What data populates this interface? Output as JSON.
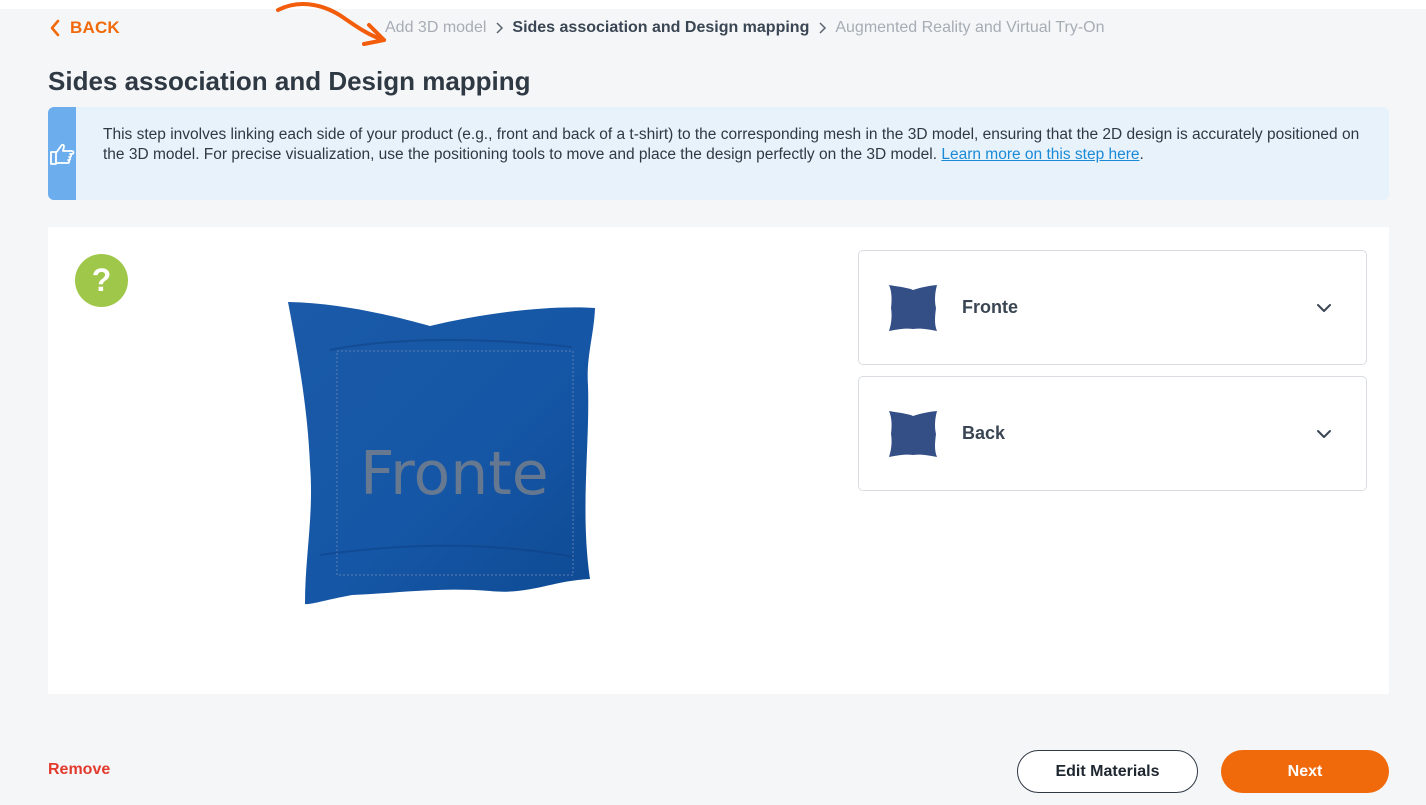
{
  "nav": {
    "back_label": "BACK",
    "breadcrumb": [
      "Add 3D model",
      "Sides association and Design mapping",
      "Augmented Reality and Virtual Try-On"
    ]
  },
  "page": {
    "title": "Sides association and Design mapping"
  },
  "info": {
    "text": "This step involves linking each side of your product (e.g., front and back of a t-shirt) to the corresponding mesh in the 3D model, ensuring that the 2D design is accurately positioned on the 3D model. For precise visualization, use the positioning tools to move and place the design perfectly on the 3D model. ",
    "link_text": "Learn more on this step here",
    "trailing": "."
  },
  "viewer": {
    "help_label": "?",
    "design_text": "Fronte"
  },
  "sides": [
    {
      "label": "Fronte"
    },
    {
      "label": "Back"
    }
  ],
  "footer": {
    "remove_label": "Remove",
    "edit_label": "Edit Materials",
    "next_label": "Next"
  },
  "colors": {
    "accent": "#f06a0c",
    "info_bar": "#6cadee",
    "info_bg": "#e8f2fb",
    "help_badge": "#9fc74a",
    "remove": "#e23b2e",
    "pillow": "#1556a6"
  }
}
